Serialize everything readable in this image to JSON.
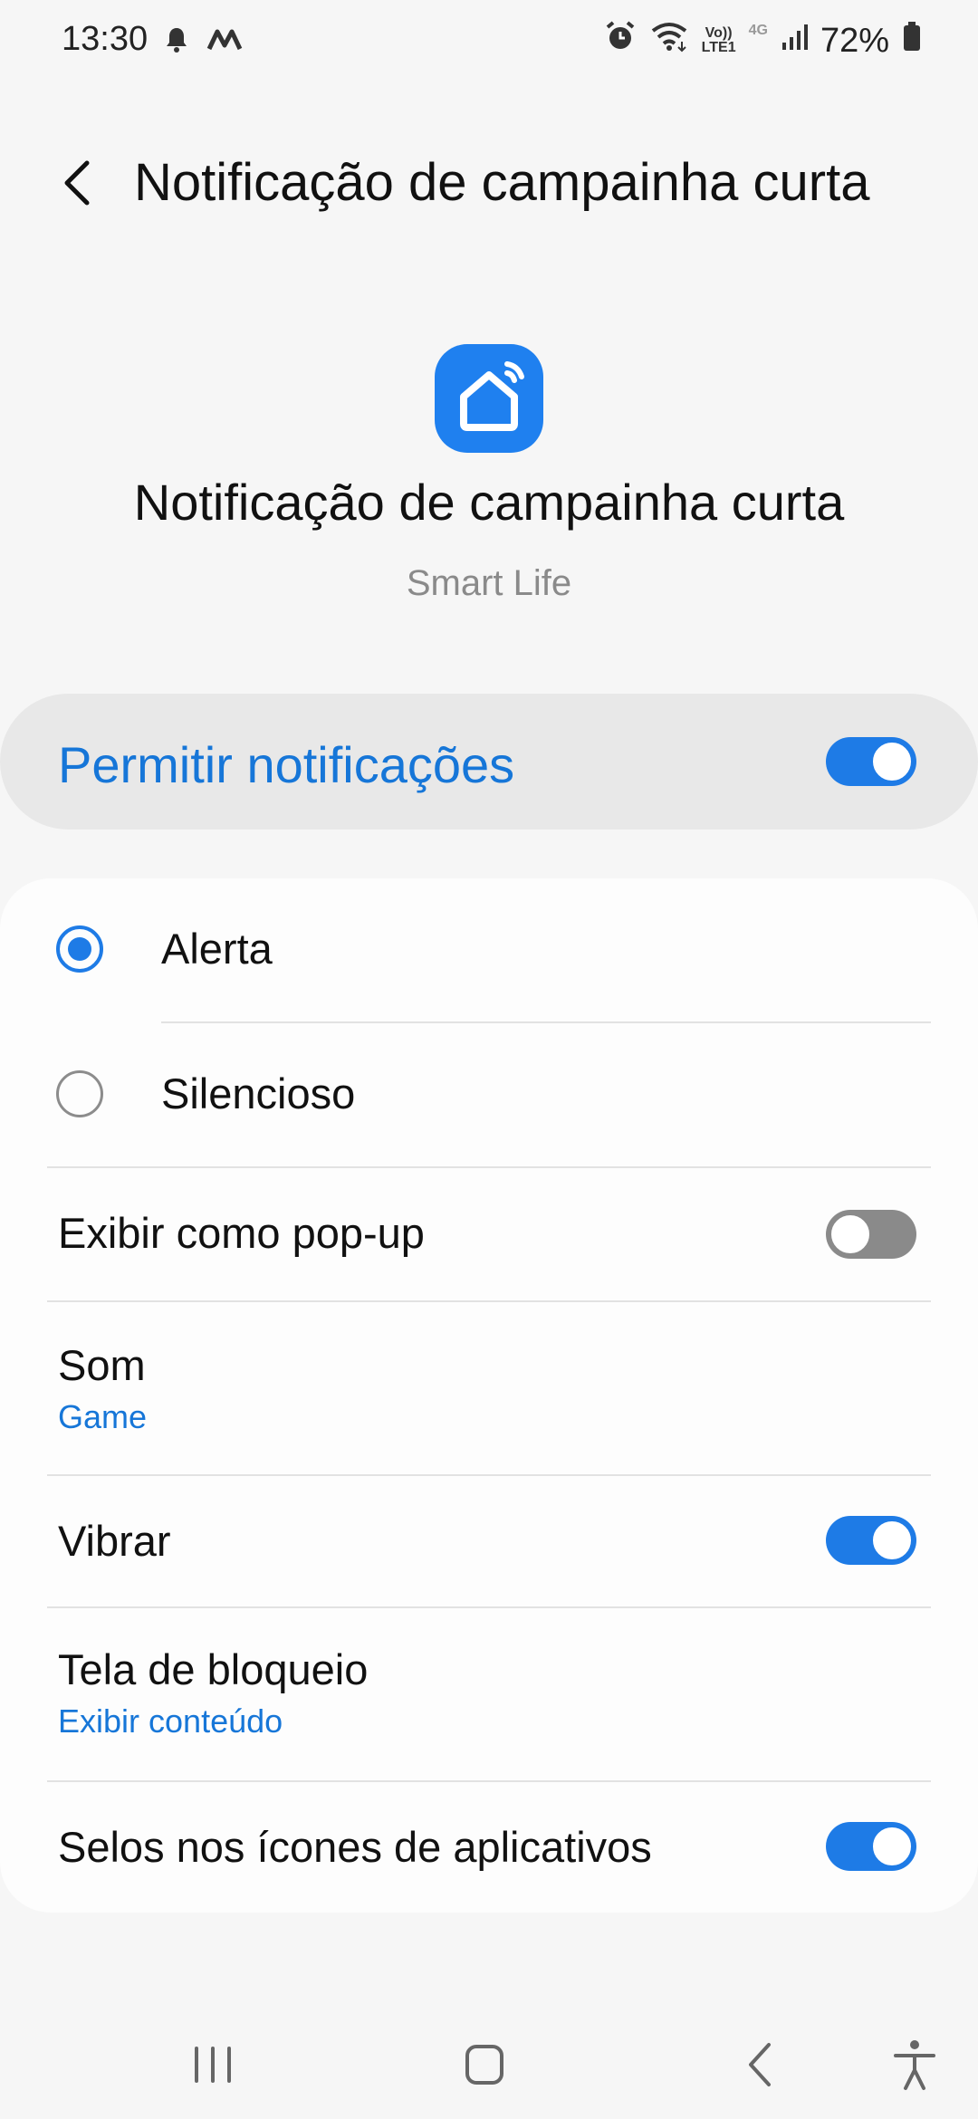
{
  "status_bar": {
    "time": "13:30",
    "left_icons": [
      "bell-icon",
      "m-app-icon"
    ],
    "right_icons": [
      "alarm-icon",
      "wifi-icon",
      "volte-icon",
      "4g-icon",
      "signal-icon",
      "battery-icon"
    ],
    "volte_line1": "Vo))",
    "volte_line2": "LTE1",
    "network": "4G",
    "battery": "72%"
  },
  "header": {
    "title": "Notificação de campainha curta",
    "back_icon": "chevron-left-icon"
  },
  "app": {
    "icon": "smart-home-icon",
    "title": "Notificação de campainha curta",
    "subtitle": "Smart Life"
  },
  "allow": {
    "label": "Permitir notificações",
    "enabled": true
  },
  "settings": {
    "alert_label": "Alerta",
    "silent_label": "Silencioso",
    "selected": "Alerta",
    "popup_label": "Exibir como pop-up",
    "popup_enabled": false,
    "sound_label": "Som",
    "sound_value": "Game",
    "vibrate_label": "Vibrar",
    "vibrate_enabled": true,
    "lockscreen_label": "Tela de bloqueio",
    "lockscreen_value": "Exibir conteúdo",
    "badges_label": "Selos nos ícones de aplicativos",
    "badges_enabled": true
  },
  "nav": {
    "items": [
      "recents-icon",
      "home-icon",
      "back-icon",
      "accessibility-icon"
    ]
  },
  "colors": {
    "accent": "#1e7be6",
    "link": "#1676d8",
    "background": "#f6f6f6",
    "card": "#fdfdfd"
  }
}
